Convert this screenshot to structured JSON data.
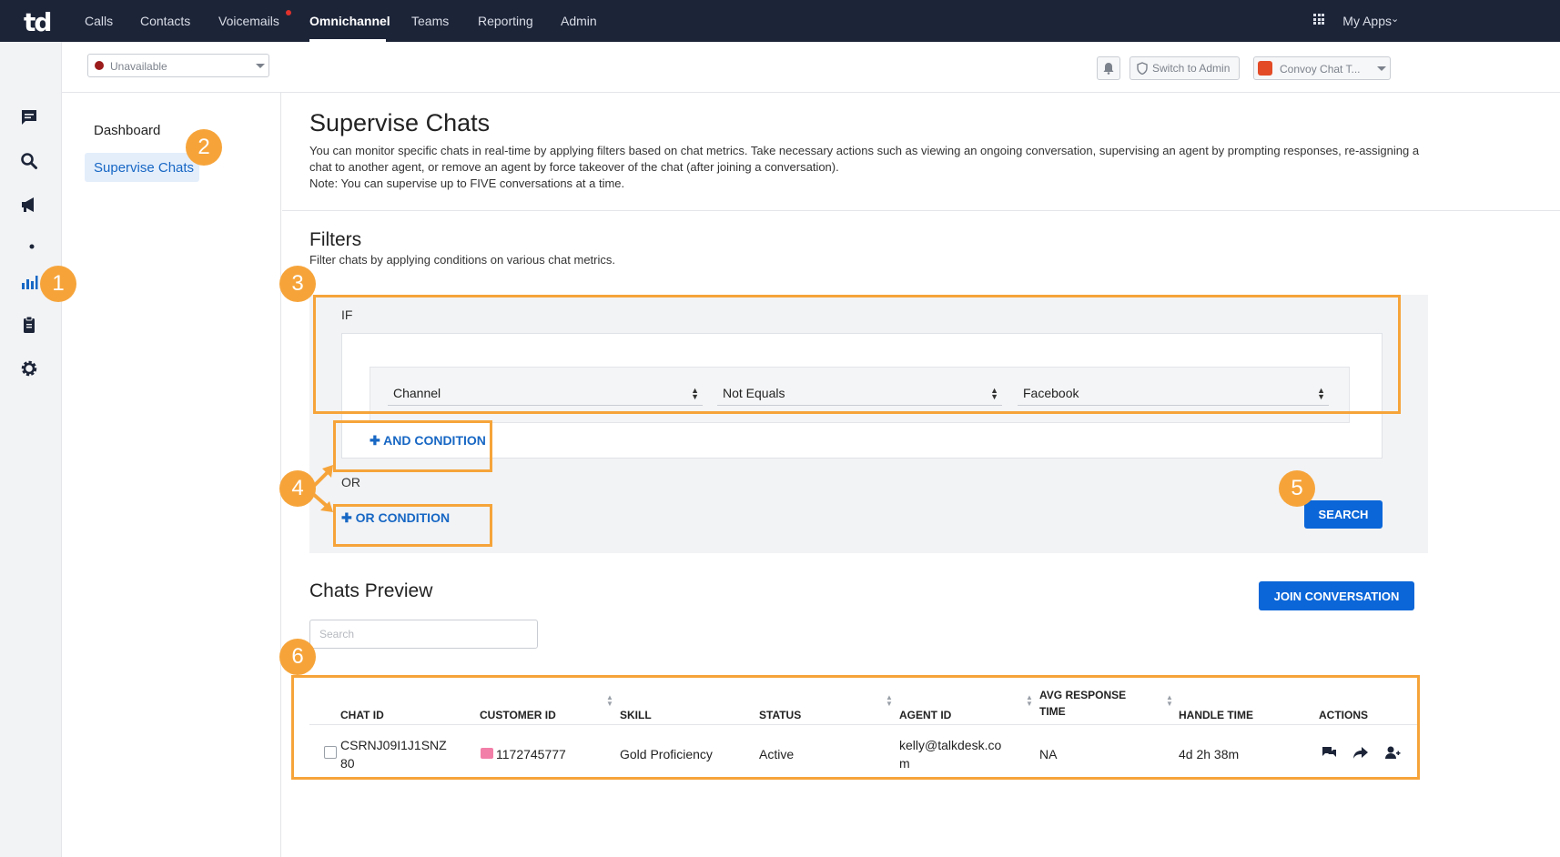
{
  "topnav": {
    "logo": "td",
    "items": [
      "Calls",
      "Contacts",
      "Voicemails",
      "Omnichannel",
      "Teams",
      "Reporting",
      "Admin"
    ],
    "active": "Omnichannel",
    "my_apps": "My Apps"
  },
  "rail": {
    "icons": [
      "chat-icon",
      "search-icon",
      "megaphone-icon",
      "dot-icon",
      "bar-chart-icon",
      "clipboard-icon",
      "gear-icon"
    ]
  },
  "subheader": {
    "status": "Unavailable",
    "status_color": "#9c1b1b",
    "switch_label": "Switch to Admin",
    "app_select": "Convoy Chat T..."
  },
  "sidebar": {
    "items": [
      {
        "label": "Dashboard"
      },
      {
        "label": "Supervise Chats"
      }
    ]
  },
  "page": {
    "title": "Supervise Chats",
    "description": "You can monitor specific chats in real-time by applying filters based on chat metrics. Take necessary actions such as viewing an ongoing conversation, supervising an agent by prompting responses, re-assigning a chat to another agent, or remove an agent by force takeover of the chat (after joining a conversation).",
    "note": "Note: You can supervise up to FIVE conversations at a time."
  },
  "filters": {
    "title": "Filters",
    "subtitle": "Filter chats by applying conditions on various chat metrics.",
    "if_label": "IF",
    "condition": {
      "field": "Channel",
      "operator": "Not Equals",
      "value": "Facebook"
    },
    "and_condition": "AND CONDITION",
    "or_label": "OR",
    "or_condition": "OR CONDITION",
    "search_button": "SEARCH"
  },
  "preview": {
    "title": "Chats Preview",
    "join_button": "JOIN CONVERSATION",
    "search_placeholder": "Search",
    "columns": [
      "CHAT ID",
      "CUSTOMER ID",
      "SKILL",
      "STATUS",
      "AGENT ID",
      "AVG RESPONSE",
      "TIME",
      "HANDLE TIME",
      "ACTIONS"
    ],
    "rows": [
      {
        "chat_id_1": "CSRNJ09I1J1SNZ",
        "chat_id_2": "80",
        "customer_id": "1172745777",
        "skill": "Gold Proficiency",
        "status": "Active",
        "agent_id_1": "kelly@talkdesk.co",
        "agent_id_2": "m",
        "avg_response": "NA",
        "handle_time": "4d 2h 38m"
      }
    ]
  },
  "annotations": [
    "1",
    "2",
    "3",
    "4",
    "5",
    "6"
  ],
  "colors": {
    "nav_bg": "#1c2438",
    "accent": "#0b66d8",
    "annotation": "#f6a43a"
  }
}
